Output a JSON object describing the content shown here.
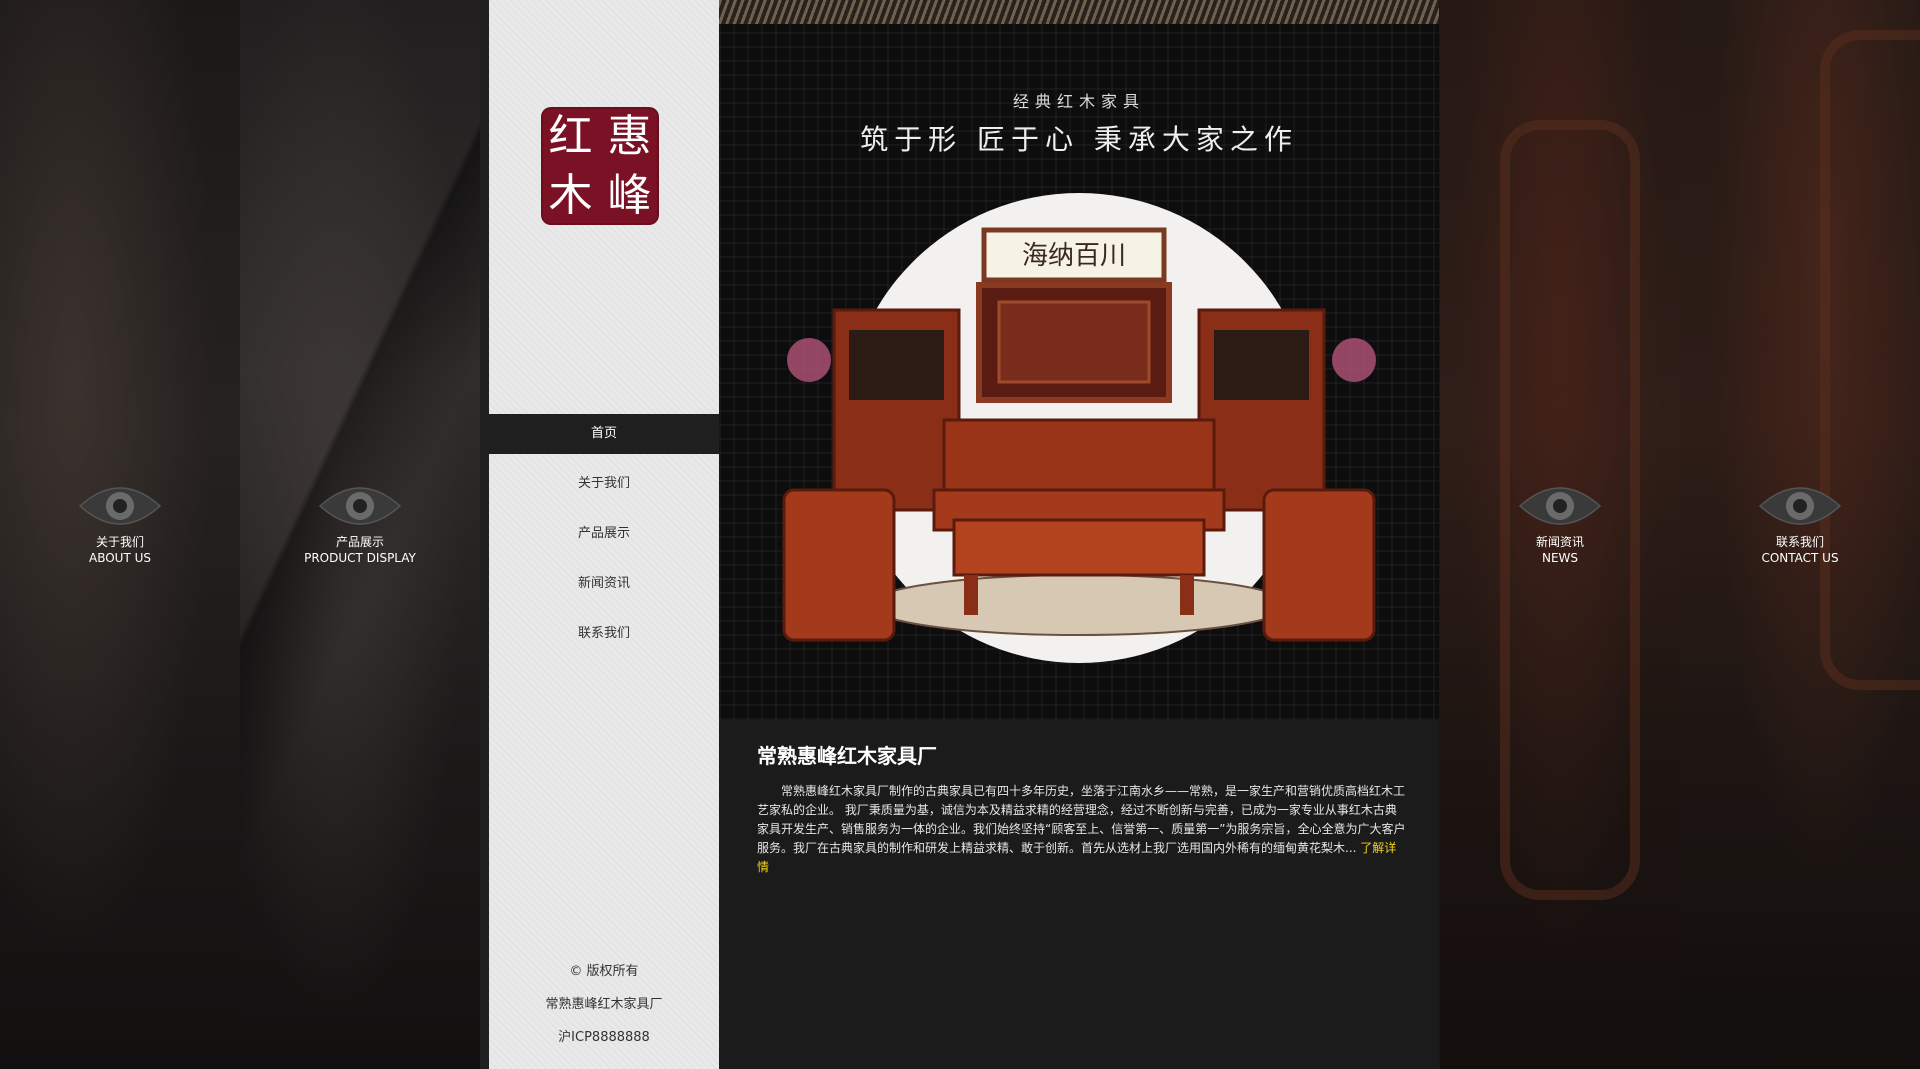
{
  "side_nav": [
    {
      "cn": "关于我们",
      "en": "ABOUT US"
    },
    {
      "cn": "产品展示",
      "en": "PRODUCT DISPLAY"
    },
    {
      "cn": "新闻资讯",
      "en": "NEWS"
    },
    {
      "cn": "联系我们",
      "en": "CONTACT US"
    }
  ],
  "logo": {
    "chars": [
      "红",
      "惠",
      "木",
      "峰"
    ],
    "color": "#7b1124"
  },
  "menu": {
    "items": [
      "首页",
      "关于我们",
      "产品展示",
      "新闻资讯",
      "联系我们"
    ],
    "active": "首页"
  },
  "footer": {
    "copyright": "© 版权所有",
    "company": "常熟惠峰红木家具厂",
    "icp": "沪ICP8888888"
  },
  "hero": {
    "subtitle": "经典红木家具",
    "slogan": "筑于形 匠于心 秉承大家之作",
    "plaque": "海纳百川"
  },
  "about": {
    "title": "常熟惠峰红木家具厂",
    "text": "常熟惠峰红木家具厂制作的古典家具已有四十多年历史，坐落于江南水乡——常熟，是一家生产和营销优质高档红木工艺家私的企业。 我厂秉质量为基，诚信为本及精益求精的经营理念，经过不断创新与完善，已成为一家专业从事红木古典家具开发生产、销售服务为一体的企业。我们始终坚持“顾客至上、信誉第一、质量第一”为服务宗旨，全心全意为广大客户服务。我厂在古典家具的制作和研发上精益求精、敢于创新。首先从选材上我厂选用国内外稀有的缅甸黄花梨木...",
    "more": "了解详情",
    "link_color": "#f2d21b"
  }
}
